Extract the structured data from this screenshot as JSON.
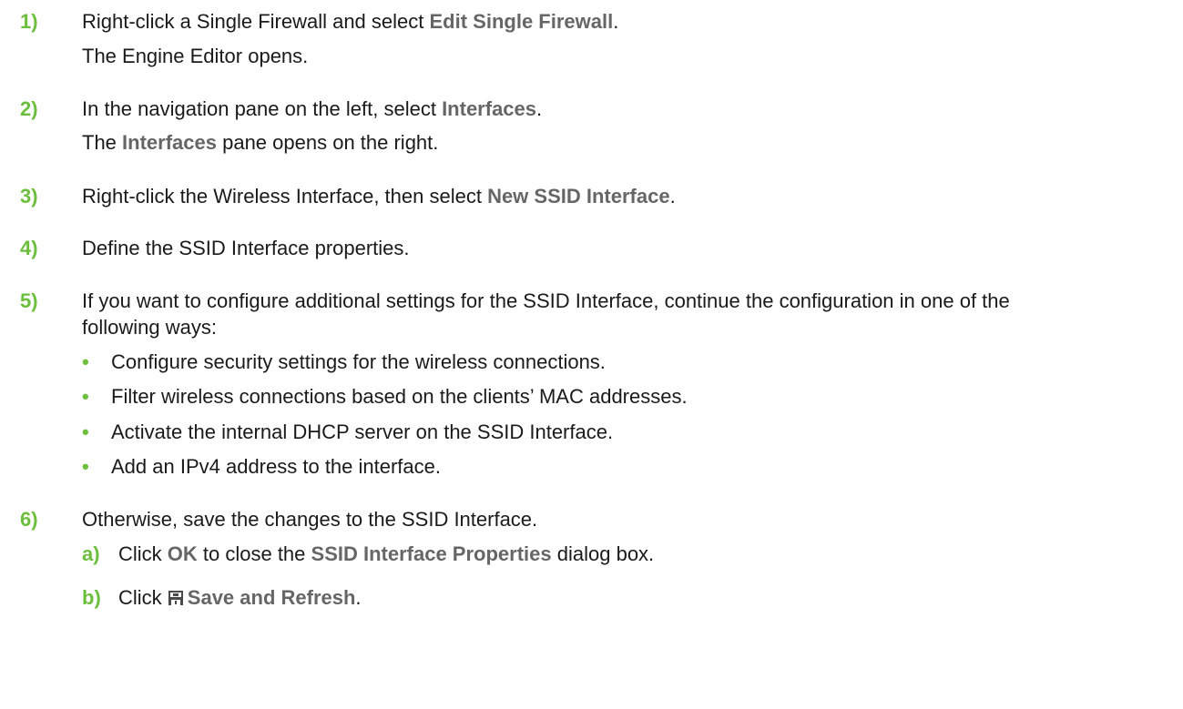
{
  "steps": [
    {
      "number": "1)",
      "pre": "Right-click a Single Firewall and select ",
      "ui": "Edit Single Firewall",
      "post": ".",
      "result": "The Engine Editor opens."
    },
    {
      "number": "2)",
      "pre": "In the navigation pane on the left, select ",
      "ui": "Interfaces",
      "post": ".",
      "result_ui": "Interfaces",
      "result_pre": "The ",
      "result_post": " pane opens on the right."
    },
    {
      "number": "3)",
      "pre": "Right-click the Wireless Interface, then select ",
      "ui": "New SSID Interface",
      "post": "."
    },
    {
      "number": "4)",
      "text": "Define the SSID Interface properties."
    },
    {
      "number": "5)",
      "line1": "If you want to configure additional settings for the SSID Interface, continue the configuration in one of the",
      "line2": "following ways:",
      "bullets": [
        "Configure security settings for the wireless connections.",
        "Filter wireless connections based on the clients’ MAC addresses.",
        "Activate the internal DHCP server on the SSID Interface.",
        "Add an IPv4 address to the interface."
      ]
    },
    {
      "number": "6)",
      "text": "Otherwise, save the changes to the SSID Interface.",
      "substeps": [
        {
          "label": "a)",
          "pre": "Click ",
          "ui": "OK",
          "mid": " to close the ",
          "ui2": "SSID Interface Properties",
          "post": " dialog box."
        },
        {
          "label": "b)",
          "pre": "Click ",
          "icon": "save-icon",
          "ui": "Save and Refresh",
          "post": "."
        }
      ]
    }
  ],
  "colors": {
    "accent": "#6cbf3c",
    "ui_text": "#666666",
    "body_text": "#1a1a1a"
  },
  "bullet_glyph": "•"
}
